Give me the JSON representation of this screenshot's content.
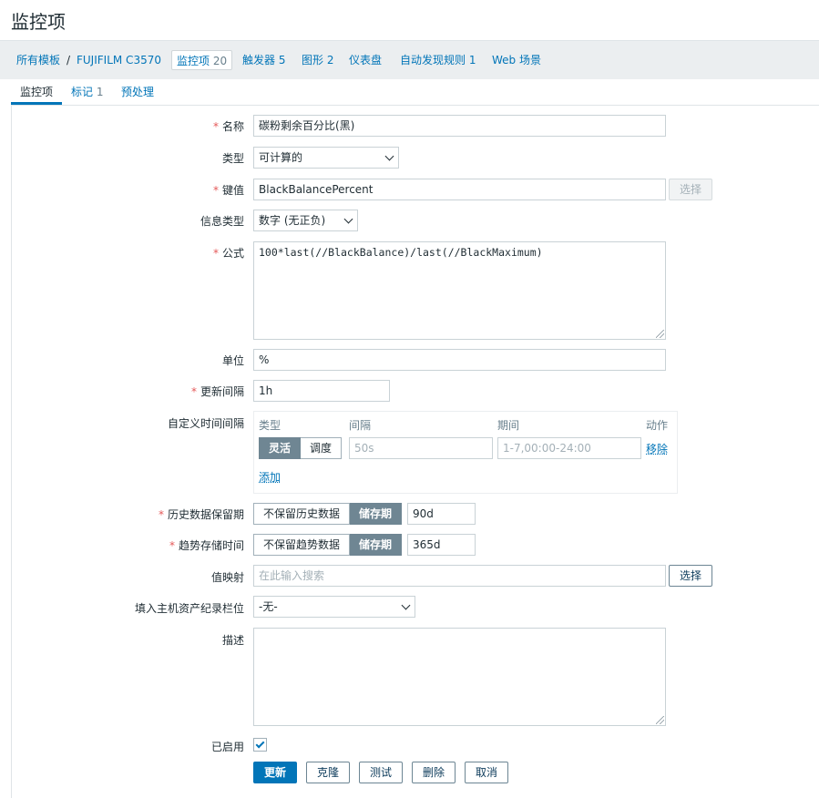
{
  "page": {
    "title": "监控项"
  },
  "breadcrumbs": {
    "all_templates": "所有模板",
    "separator": "/",
    "host": "FUJIFILM C3570",
    "items_label": "监控项",
    "items_count": "20",
    "triggers_label": "触发器",
    "triggers_count": "5",
    "graphs_label": "图形",
    "graphs_count": "2",
    "dashboards_label": "仪表盘",
    "discovery_label": "自动发现规则",
    "discovery_count": "1",
    "web_label": "Web 场景"
  },
  "tabs": {
    "item": "监控项",
    "tags_label": "标记",
    "tags_count": "1",
    "preprocessing": "预处理"
  },
  "form": {
    "name": {
      "label": "名称",
      "value": "碳粉剩余百分比(黑)"
    },
    "type": {
      "label": "类型",
      "value": "可计算的"
    },
    "key": {
      "label": "键值",
      "value": "BlackBalancePercent",
      "button": "选择"
    },
    "value_type": {
      "label": "信息类型",
      "value": "数字 (无正负)"
    },
    "formula": {
      "label": "公式",
      "value": "100*last(//BlackBalance)/last(//BlackMaximum)"
    },
    "units": {
      "label": "单位",
      "value": "%"
    },
    "delay": {
      "label": "更新间隔",
      "value": "1h"
    },
    "custom_intervals": {
      "label": "自定义时间间隔",
      "col_type": "类型",
      "col_interval": "间隔",
      "col_period": "期间",
      "col_action": "动作",
      "flexible": "灵活",
      "scheduling": "调度",
      "interval_placeholder": "50s",
      "period_placeholder": "1-7,00:00-24:00",
      "remove": "移除",
      "add": "添加"
    },
    "history": {
      "label": "历史数据保留期",
      "do_not_keep": "不保留历史数据",
      "storage": "储存期",
      "value": "90d"
    },
    "trends": {
      "label": "趋势存储时间",
      "do_not_keep": "不保留趋势数据",
      "storage": "储存期",
      "value": "365d"
    },
    "valuemap": {
      "label": "值映射",
      "placeholder": "在此输入搜索",
      "button": "选择"
    },
    "inventory": {
      "label": "填入主机资产纪录栏位",
      "value": "-无-"
    },
    "description": {
      "label": "描述",
      "value": ""
    },
    "enabled": {
      "label": "已启用",
      "checked": true
    }
  },
  "actions": {
    "update": "更新",
    "clone": "克隆",
    "test": "测试",
    "delete": "删除",
    "cancel": "取消"
  },
  "colors": {
    "accent": "#0275b8",
    "required": "#e45959",
    "segment_on": "#6f8693"
  }
}
